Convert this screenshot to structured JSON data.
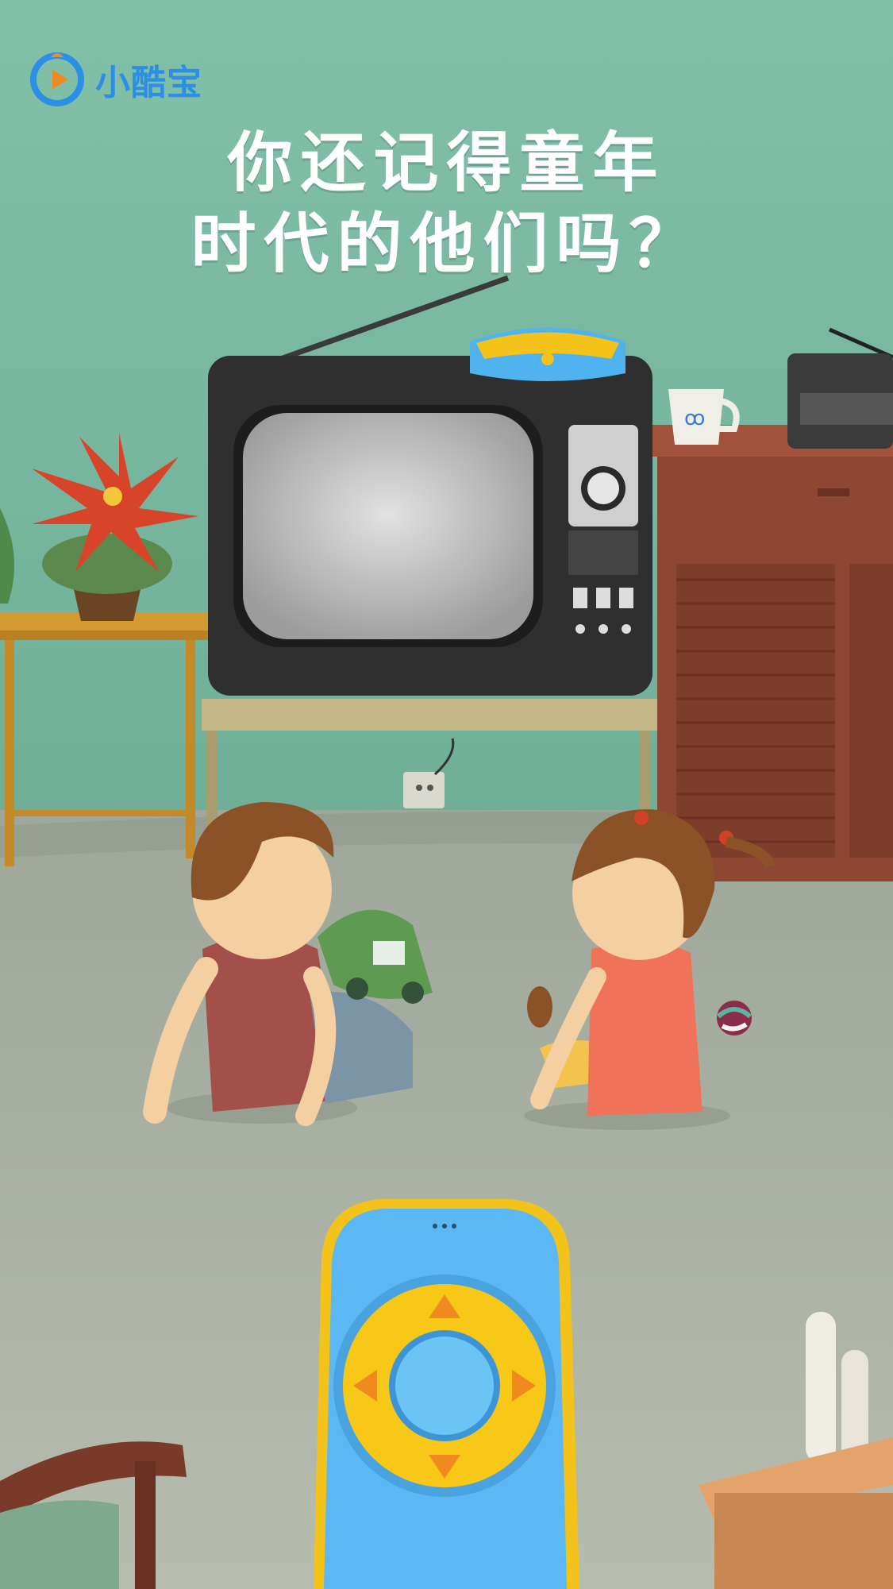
{
  "brand": {
    "name": "小酷宝",
    "logo_icon": "play-smile-icon",
    "color": "#2b8fe8"
  },
  "headline": {
    "line1": "你还记得童年",
    "line2": "时代的他们吗？"
  },
  "illustration": {
    "wall_color": "#79b8a0",
    "floor_color": "#a9b1a1",
    "elements": [
      "retro-tv",
      "tv-antenna",
      "speaker-on-tv",
      "mug",
      "radio",
      "cabinet",
      "poinsettia-plant",
      "side-table",
      "tv-stand",
      "wall-socket",
      "boy",
      "girl",
      "toy-car",
      "toy-ball",
      "remote-control",
      "wooden-chair",
      "cardboard-box"
    ]
  }
}
